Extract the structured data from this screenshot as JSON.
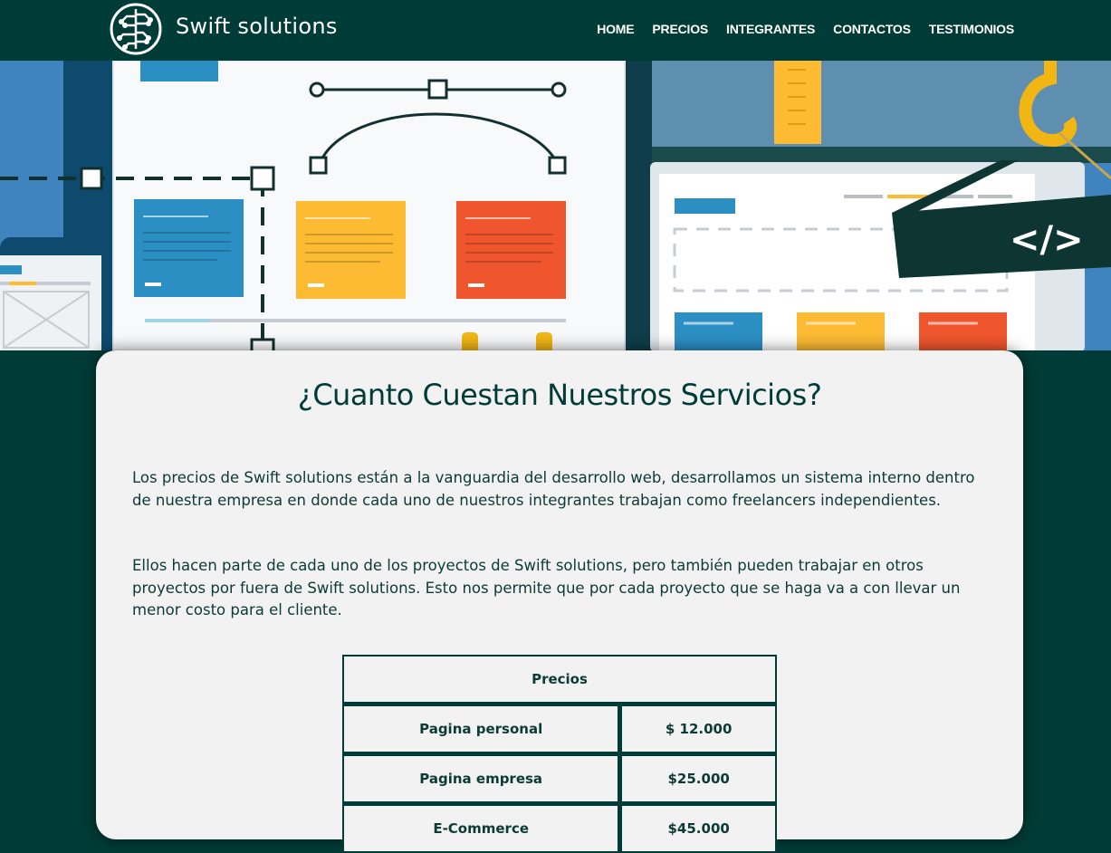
{
  "brand": {
    "name": "Swift solutions",
    "logo_icon": "circuit-brain-icon"
  },
  "nav": {
    "items": [
      "HOME",
      "PRECIOS",
      "INTEGRANTES",
      "CONTACTOS",
      "TESTIMONIOS"
    ]
  },
  "hero": {
    "icon": "web-design-illustration",
    "code_badge": "</>"
  },
  "main": {
    "title": "¿Cuanto Cuestan Nuestros Servicios?",
    "paragraphs": [
      "Los precios de Swift solutions están a la vanguardia del desarrollo web, desarrollamos un sistema interno dentro de nuestra empresa en donde cada uno de nuestros integrantes trabajan como freelancers independientes.",
      "Ellos hacen parte de cada uno de los proyectos de Swift solutions, pero también pueden trabajar en otros proyectos por fuera de Swift solutions. Esto nos permite que por cada proyecto que se haga va a con llevar un menor costo para el cliente."
    ],
    "table": {
      "header": "Precios",
      "rows": [
        {
          "service": "Pagina personal",
          "price": "$ 12.000"
        },
        {
          "service": "Pagina empresa",
          "price": "$25.000"
        },
        {
          "service": "E-Commerce",
          "price": "$45.000"
        }
      ]
    }
  },
  "colors": {
    "primary": "#003c37",
    "card": "#f2f2f2",
    "text": "#0c3a35"
  }
}
